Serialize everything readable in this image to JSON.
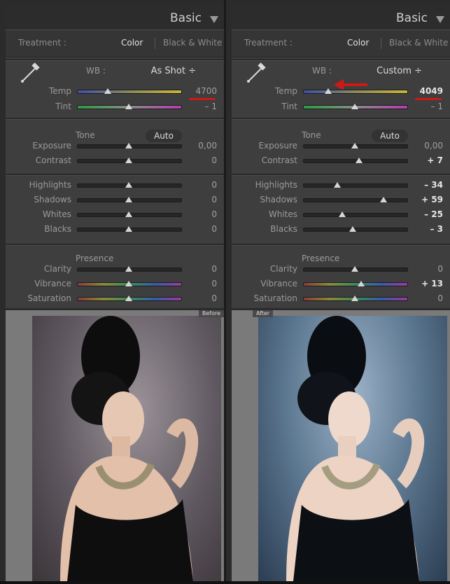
{
  "panels": {
    "before": {
      "header_title": "Basic",
      "treatment_label": "Treatment :",
      "treatment_color": "Color",
      "treatment_bw": "Black & White",
      "wb_label": "WB :",
      "wb_value": "As Shot ÷",
      "tone_label": "Tone",
      "auto_label": "Auto",
      "presence_label": "Presence",
      "photo_tag": "Before",
      "sliders": [
        {
          "label": "Temp",
          "value": "4700",
          "pos": 0.3
        },
        {
          "label": "Tint",
          "value": "– 1",
          "pos": 0.5
        },
        {
          "label": "Exposure",
          "value": "0,00",
          "pos": 0.5
        },
        {
          "label": "Contrast",
          "value": "0",
          "pos": 0.5
        },
        {
          "label": "Highlights",
          "value": "0",
          "pos": 0.5
        },
        {
          "label": "Shadows",
          "value": "0",
          "pos": 0.5
        },
        {
          "label": "Whites",
          "value": "0",
          "pos": 0.5
        },
        {
          "label": "Blacks",
          "value": "0",
          "pos": 0.5
        },
        {
          "label": "Clarity",
          "value": "0",
          "pos": 0.5
        },
        {
          "label": "Vibrance",
          "value": "0",
          "pos": 0.5
        },
        {
          "label": "Saturation",
          "value": "0",
          "pos": 0.5
        }
      ]
    },
    "after": {
      "header_title": "Basic",
      "treatment_label": "Treatment :",
      "treatment_color": "Color",
      "treatment_bw": "Black & White",
      "wb_label": "WB :",
      "wb_value": "Custom ÷",
      "tone_label": "Tone",
      "auto_label": "Auto",
      "presence_label": "Presence",
      "photo_tag": "After",
      "sliders": [
        {
          "label": "Temp",
          "value": "4049",
          "pos": 0.24
        },
        {
          "label": "Tint",
          "value": "– 1",
          "pos": 0.5
        },
        {
          "label": "Exposure",
          "value": "0,00",
          "pos": 0.5
        },
        {
          "label": "Contrast",
          "value": "+ 7",
          "pos": 0.54
        },
        {
          "label": "Highlights",
          "value": "– 34",
          "pos": 0.33
        },
        {
          "label": "Shadows",
          "value": "+ 59",
          "pos": 0.78
        },
        {
          "label": "Whites",
          "value": "– 25",
          "pos": 0.38
        },
        {
          "label": "Blacks",
          "value": "– 3",
          "pos": 0.48
        },
        {
          "label": "Clarity",
          "value": "0",
          "pos": 0.5
        },
        {
          "label": "Vibrance",
          "value": "+ 13",
          "pos": 0.56
        },
        {
          "label": "Saturation",
          "value": "0",
          "pos": 0.5
        }
      ]
    }
  },
  "colors": {
    "annotation_red": "#d01818",
    "panel_bg": "#3e3e3e",
    "header_bg": "#2c2c2c"
  }
}
